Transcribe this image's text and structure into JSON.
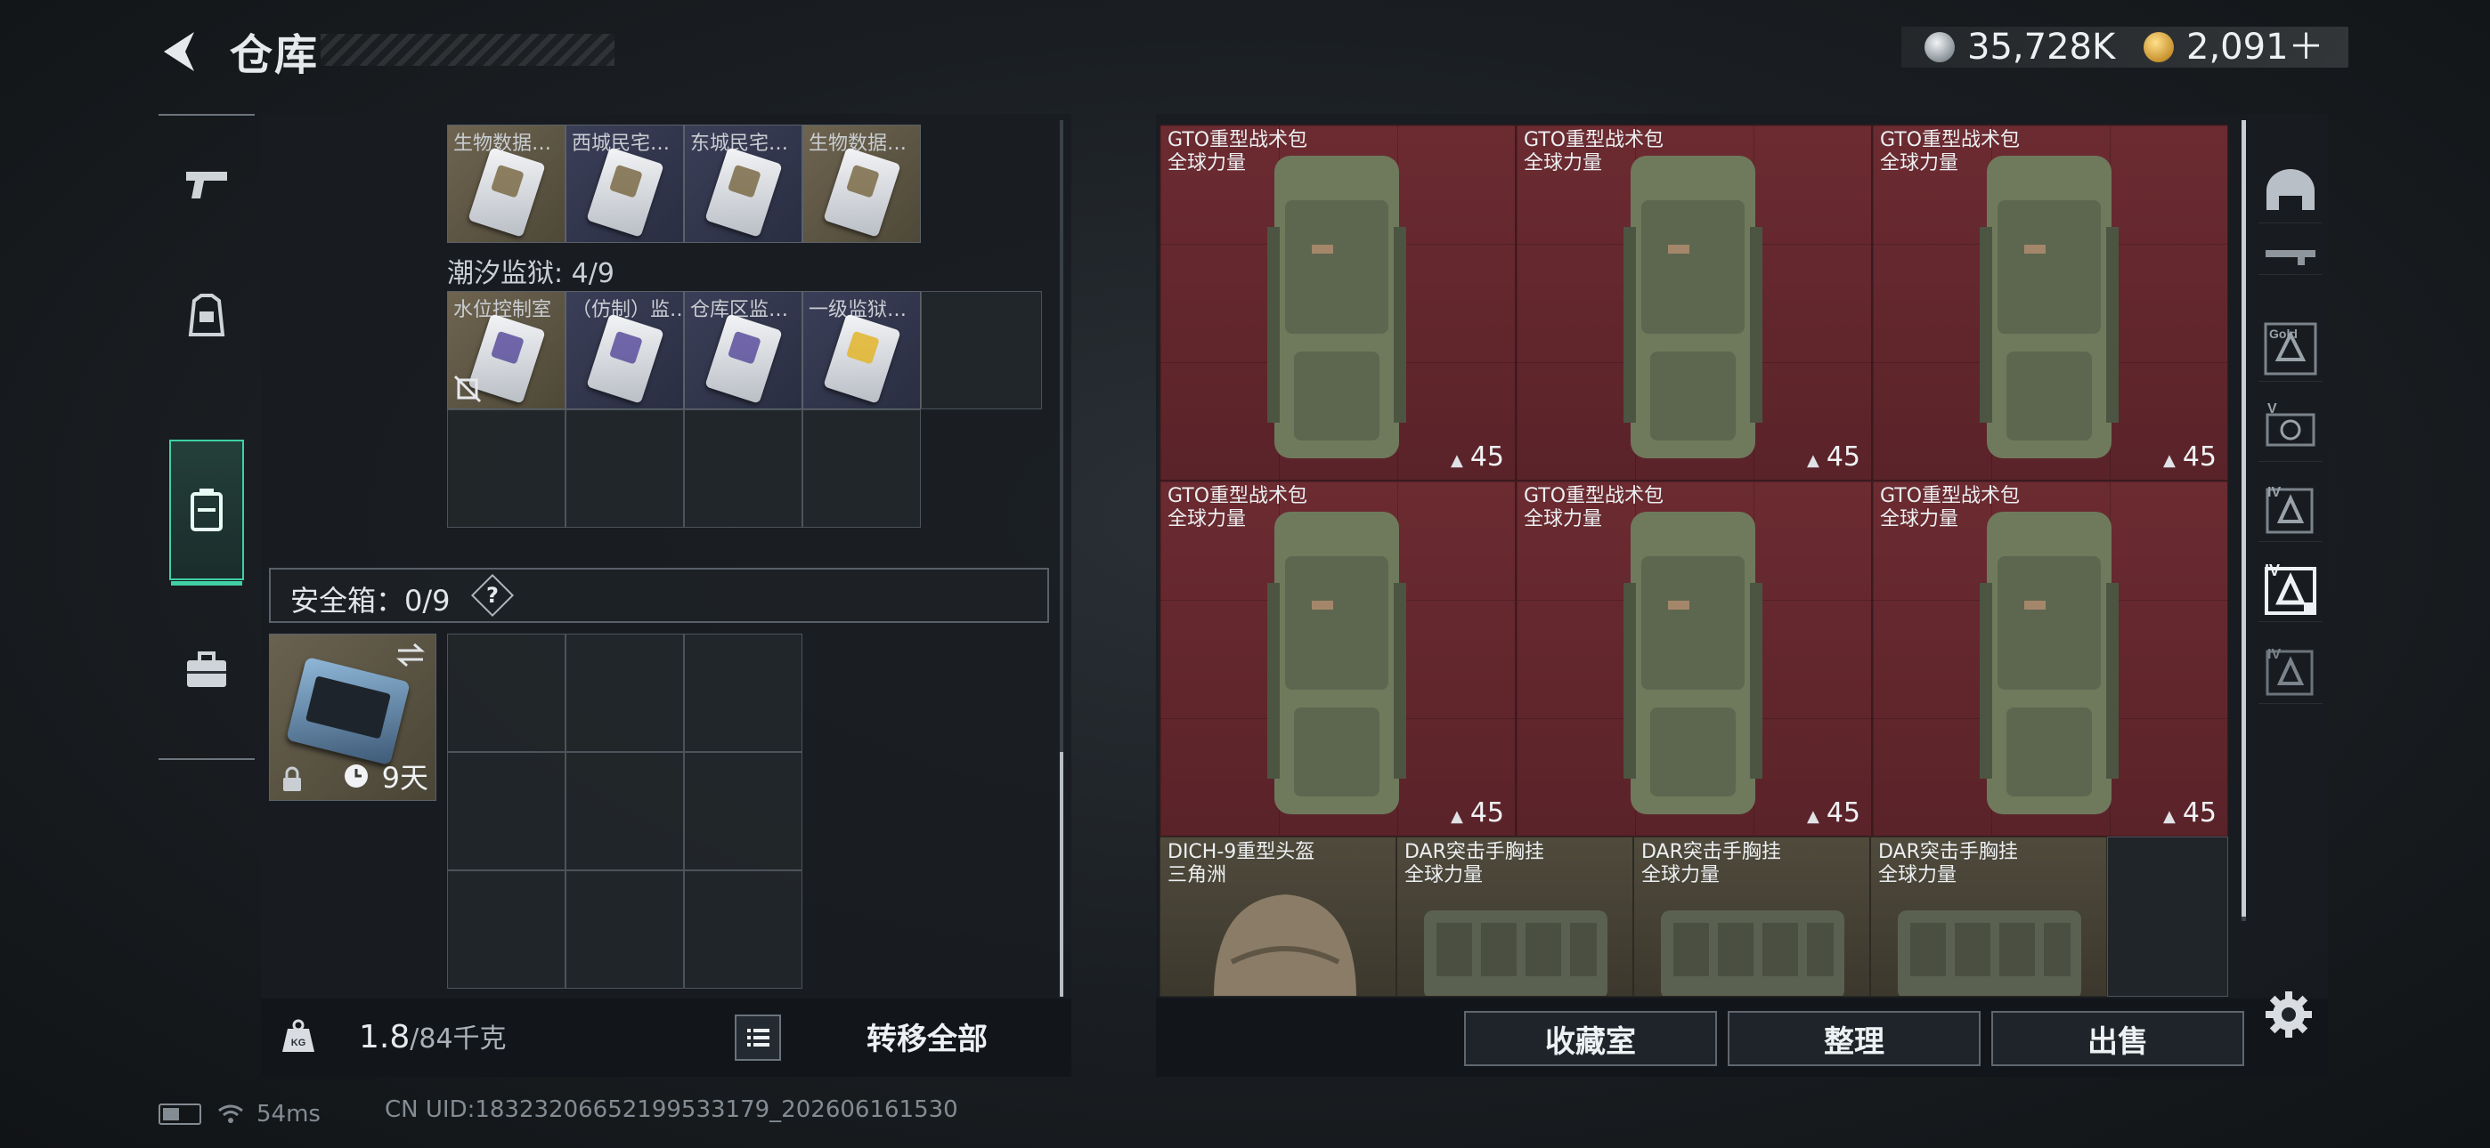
{
  "header": {
    "title": "仓库",
    "currency": [
      {
        "icon": "silver-coin-icon",
        "value": "35,728K"
      },
      {
        "icon": "gold-coin-icon",
        "value": "2,091＋"
      }
    ]
  },
  "rail": {
    "tabs": [
      {
        "name": "weapon-tab",
        "icon": "pistol-icon"
      },
      {
        "name": "equipment-tab",
        "icon": "armor-icon"
      },
      {
        "name": "storage-tab",
        "icon": "backpack-icon",
        "active": true
      },
      {
        "name": "case-tab",
        "icon": "briefcase-icon"
      }
    ]
  },
  "storage": {
    "row1": [
      {
        "label": "生物数据…",
        "bg": "tan",
        "card": "stripe"
      },
      {
        "label": "西城民宅…",
        "bg": "navy",
        "card": "stripe"
      },
      {
        "label": "东城民宅…",
        "bg": "navy",
        "card": "stripe"
      },
      {
        "label": "生物数据…",
        "bg": "tan",
        "card": "stripe"
      }
    ],
    "prison_label": "潮汐监狱: 4/9",
    "row2": [
      {
        "label": "水位控制室",
        "bg": "tan",
        "card": "purple"
      },
      {
        "label": "（仿制）监…",
        "bg": "navy",
        "card": "purple"
      },
      {
        "label": "仓库区监…",
        "bg": "navy",
        "card": "purple"
      },
      {
        "label": "一级监狱…",
        "bg": "navy",
        "card": "yellow"
      }
    ],
    "safe_label": "安全箱：0/9",
    "help": "?",
    "safebox_days": "9天",
    "weight_current": "1.8",
    "weight_max": "/84千克",
    "transfer_all": "转移全部"
  },
  "inventory": {
    "bags": [
      {
        "name": "GTO重型战术包",
        "source": "全球力量",
        "count": "45"
      },
      {
        "name": "GTO重型战术包",
        "source": "全球力量",
        "count": "45"
      },
      {
        "name": "GTO重型战术包",
        "source": "全球力量",
        "count": "45"
      },
      {
        "name": "GTO重型战术包",
        "source": "全球力量",
        "count": "45"
      },
      {
        "name": "GTO重型战术包",
        "source": "全球力量",
        "count": "45"
      },
      {
        "name": "GTO重型战术包",
        "source": "全球力量",
        "count": "45"
      }
    ],
    "gear": [
      {
        "name": "DICH-9重型头盔",
        "source": "三角洲",
        "type": "helmet"
      },
      {
        "name": "DAR突击手胸挂",
        "source": "全球力量",
        "type": "vest"
      },
      {
        "name": "DAR突击手胸挂",
        "source": "全球力量",
        "type": "vest"
      },
      {
        "name": "DAR突击手胸挂",
        "source": "全球力量",
        "type": "vest"
      }
    ],
    "buttons": {
      "favorites": "收藏室",
      "sort": "整理",
      "sell": "出售"
    }
  },
  "filters": [
    {
      "name": "filter-helmet",
      "label": "",
      "icon": "helmet-icon"
    },
    {
      "name": "filter-rifle",
      "label": "",
      "icon": "rifle-icon"
    },
    {
      "name": "filter-level-gold",
      "label": "Gold",
      "icon": "armor-level-icon"
    },
    {
      "name": "filter-level-v",
      "label": "V",
      "icon": "armor-level-icon"
    },
    {
      "name": "filter-level-iv-a",
      "label": "IV",
      "icon": "armor-level-icon"
    },
    {
      "name": "filter-level-iv-b",
      "label": "IV",
      "icon": "armor-level-icon",
      "active": true
    },
    {
      "name": "filter-level-iv-c",
      "label": "IV",
      "icon": "armor-level-icon"
    }
  ],
  "status": {
    "ping": "54ms",
    "uid": "CN UID:18323206652199533179_202606161530"
  },
  "colors": {
    "accent": "#3fd0a4",
    "bag_background": "#6b2b31",
    "gear_background": "#4f4a3c"
  }
}
